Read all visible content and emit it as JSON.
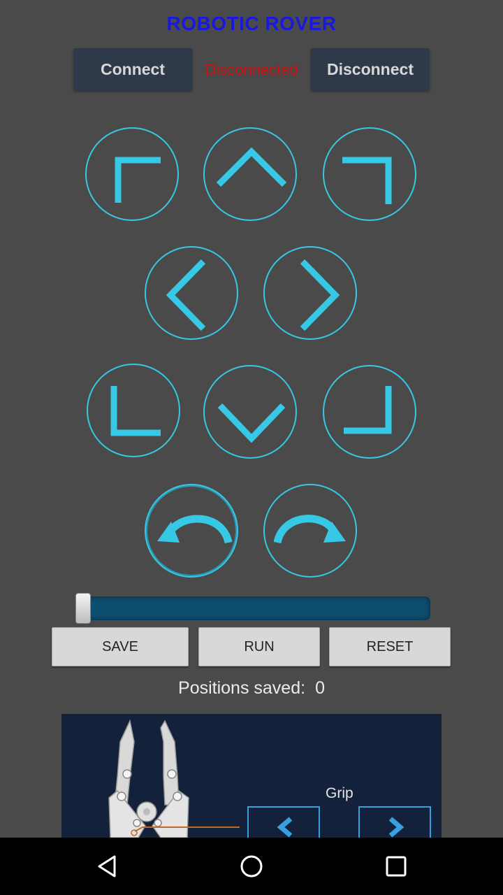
{
  "app": {
    "title": "ROBOTIC ROVER"
  },
  "connection": {
    "connect_label": "Connect",
    "status": "Disconnected",
    "disconnect_label": "Disconnect"
  },
  "controls": {
    "buttons": [
      "up-left",
      "up",
      "up-right",
      "left",
      "right",
      "down-left",
      "down",
      "down-right",
      "rotate-left",
      "rotate-right"
    ]
  },
  "slider": {
    "value_fraction": 0.0
  },
  "actions": {
    "save_label": "SAVE",
    "run_label": "RUN",
    "reset_label": "RESET"
  },
  "positions": {
    "label": "Positions saved:",
    "count": "0"
  },
  "grip": {
    "label": "Grip"
  },
  "colors": {
    "accent": "#36c8e4",
    "background": "#4a4a4a",
    "title": "#1818e0",
    "status": "#cc1010"
  },
  "navbar": {
    "icons": [
      "back-icon",
      "home-icon",
      "recents-icon"
    ]
  }
}
